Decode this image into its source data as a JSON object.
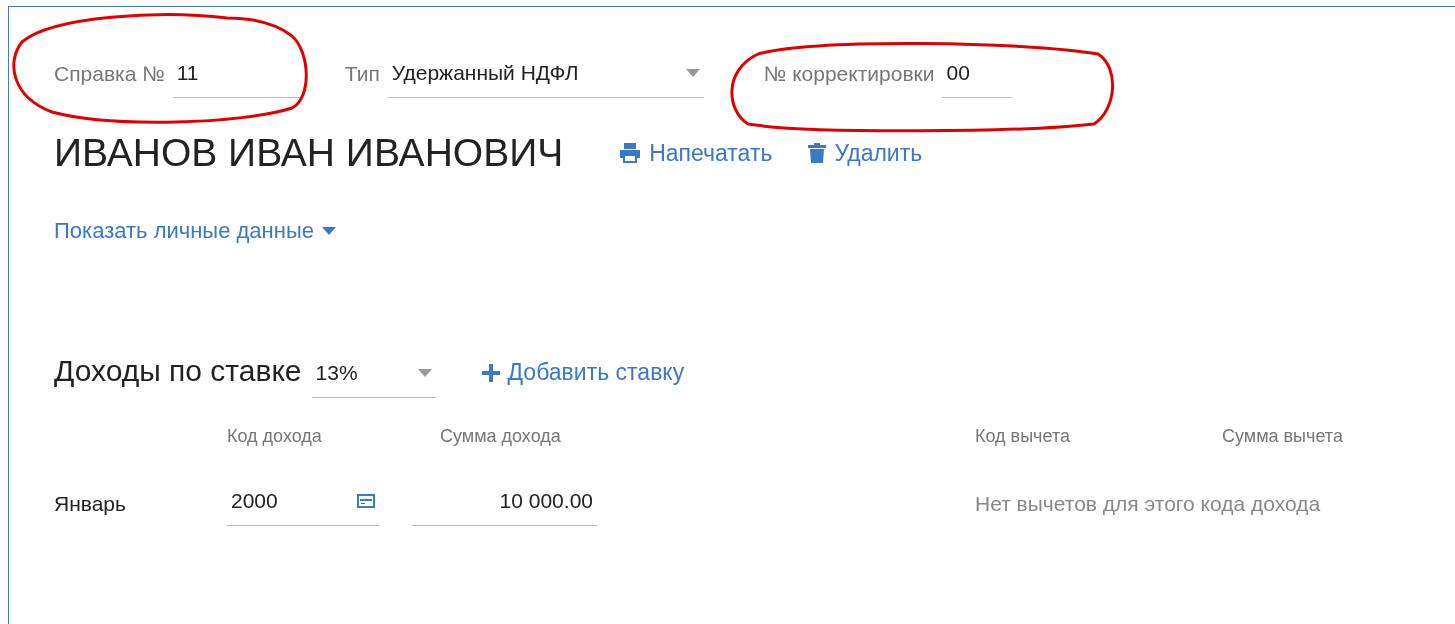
{
  "header": {
    "certificate": {
      "label": "Справка №",
      "value": "11"
    },
    "type": {
      "label": "Тип",
      "value": "Удержанный НДФЛ"
    },
    "correction": {
      "label": "№ корректировки",
      "value": "00"
    }
  },
  "person": {
    "name": "ИВАНОВ ИВАН ИВАНОВИЧ",
    "actions": [
      {
        "kind": "print",
        "label": "Напечатать"
      },
      {
        "kind": "delete",
        "label": "Удалить"
      }
    ],
    "details_toggle": {
      "label": "Показать личные данные",
      "expanded": false
    }
  },
  "income": {
    "title": "Доходы по ставке",
    "rate": "13%",
    "add_rate": "Добавить ставку",
    "columns": [
      "Код дохода",
      "Сумма дохода",
      "Код вычета",
      "Сумма вычета"
    ],
    "rows": [
      {
        "month": "Январь",
        "income_code": "2000",
        "income_amount": "10 000.00",
        "deductions_note": "Нет вычетов для этого кода дохода"
      }
    ]
  }
}
